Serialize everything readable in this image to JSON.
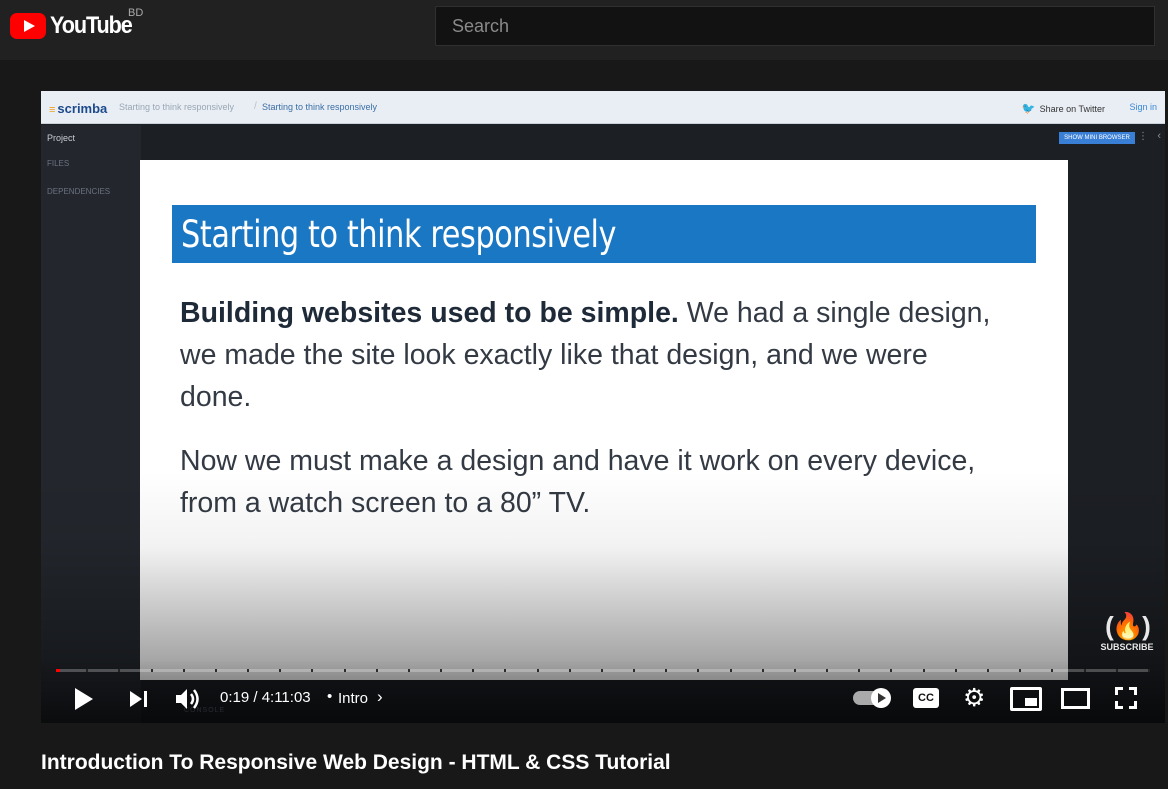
{
  "masthead": {
    "logo_text": "YouTube",
    "country_code": "BD",
    "search_placeholder": "Search"
  },
  "scrimba": {
    "logo": "scrimba",
    "breadcrumb_parent": "Starting to think responsively",
    "breadcrumb_current": "Starting to think responsively",
    "share": "Share on Twitter",
    "signin": "Sign in",
    "sidebar": {
      "project": "Project",
      "files": "FILES",
      "dependencies": "DEPENDENCIES"
    },
    "mini_browser_button": "SHOW MINI BROWSER",
    "console_label": "CONSOLE"
  },
  "slide": {
    "title": "Starting to think responsively",
    "p1_bold": "Building websites used to be simple.",
    "p1_rest": " We had a single design, we made the site look exactly like that design, and we were done.",
    "p2": "Now we must make a design and have it work on every device, from a watch screen to a 80” TV."
  },
  "watermark": {
    "icon": "(🔥)",
    "label": "SUBSCRIBE"
  },
  "controls": {
    "current_time": "0:19",
    "duration": "4:11:03",
    "time_display": "0:19 / 4:11:03",
    "separator": "•",
    "chapter": "Intro",
    "progress_fraction": 0.0013,
    "cc_label": "CC",
    "icons": [
      "play-icon",
      "next-icon",
      "volume-icon",
      "autoplay-toggle-icon",
      "captions-icon",
      "settings-icon",
      "miniplayer-icon",
      "theater-icon",
      "fullscreen-icon"
    ]
  },
  "video": {
    "title": "Introduction To Responsive Web Design - HTML & CSS Tutorial"
  },
  "colors": {
    "youtube_red": "#ff0000",
    "slide_title_bg": "#1a77c4",
    "page_bg": "#181818"
  }
}
